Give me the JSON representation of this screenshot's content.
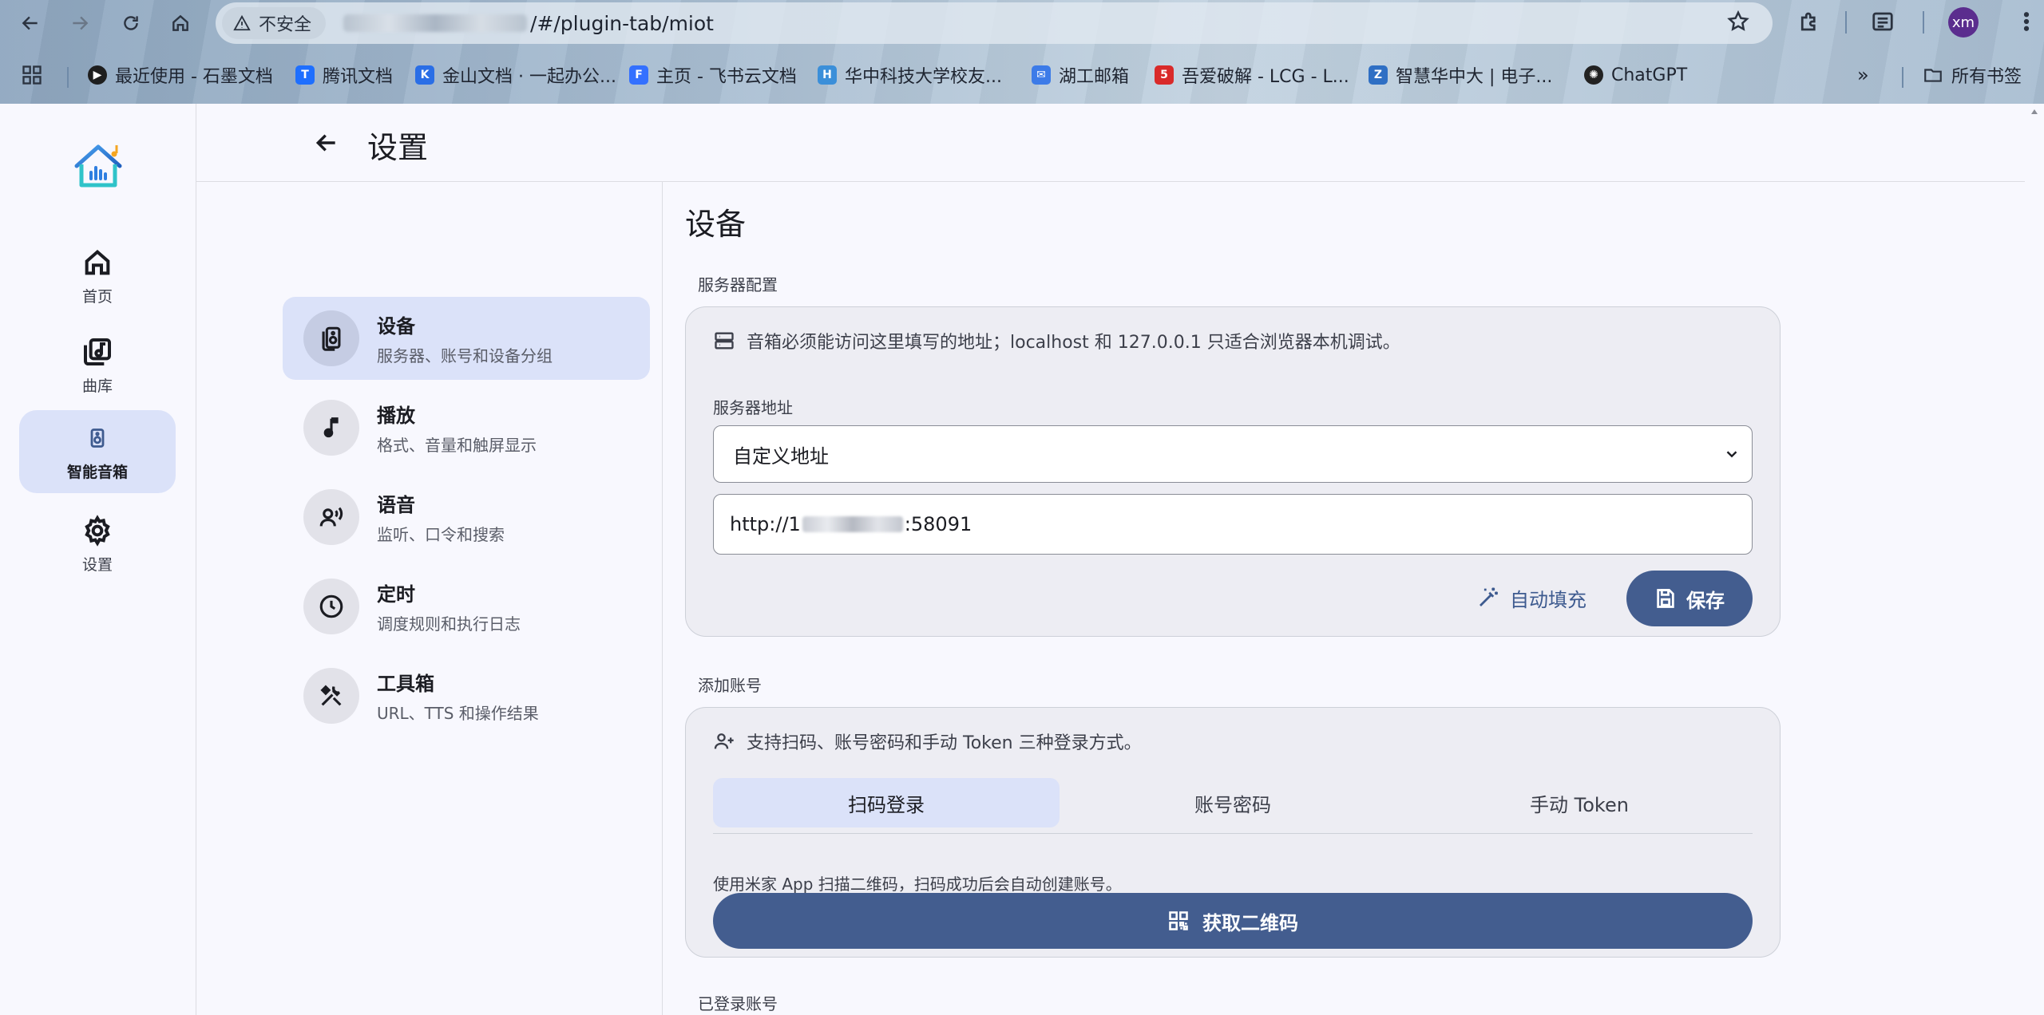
{
  "browser": {
    "security_label": "不安全",
    "url_suffix": "/#/plugin-tab/miot",
    "profile_initials": "xm",
    "bookmarks": [
      {
        "label": "最近使用 - 石墨文档",
        "icon": "shimo-icon",
        "color": "#1e1e1e"
      },
      {
        "label": "腾讯文档",
        "icon": "tencent-docs-icon",
        "color": "#1e6fff"
      },
      {
        "label": "金山文档 · 一起办公...",
        "icon": "kdocs-icon",
        "color": "#2a6ee6"
      },
      {
        "label": "主页 - 飞书云文档",
        "icon": "feishu-icon",
        "color": "#3370ff"
      },
      {
        "label": "华中科技大学校友...",
        "icon": "hust-icon",
        "color": "#3b8fd9"
      },
      {
        "label": "湖工邮箱",
        "icon": "mail-icon",
        "color": "#3c7be8"
      },
      {
        "label": "吾爱破解 - LCG - L...",
        "icon": "52pojie-icon",
        "color": "#d92a2a"
      },
      {
        "label": "智慧华中大 | 电子...",
        "icon": "hust-smart-icon",
        "color": "#2f6fc4"
      },
      {
        "label": "ChatGPT",
        "icon": "chatgpt-icon",
        "color": "#222222"
      }
    ],
    "all_bookmarks_label": "所有书签"
  },
  "rail": {
    "items": [
      {
        "label": "首页",
        "icon": "home-icon"
      },
      {
        "label": "曲库",
        "icon": "library-icon"
      },
      {
        "label": "智能音箱",
        "icon": "speaker-icon"
      },
      {
        "label": "设置",
        "icon": "gear-icon"
      }
    ]
  },
  "header": {
    "title": "设置"
  },
  "settings_nav": [
    {
      "title": "设备",
      "subtitle": "服务器、账号和设备分组",
      "icon": "devices-icon"
    },
    {
      "title": "播放",
      "subtitle": "格式、音量和触屏显示",
      "icon": "music-note-icon"
    },
    {
      "title": "语音",
      "subtitle": "监听、口令和搜索",
      "icon": "voice-icon"
    },
    {
      "title": "定时",
      "subtitle": "调度规则和执行日志",
      "icon": "clock-icon"
    },
    {
      "title": "工具箱",
      "subtitle": "URL、TTS 和操作结果",
      "icon": "tools-icon"
    }
  ],
  "content": {
    "title": "设备",
    "server_group_label": "服务器配置",
    "server_hint": "音箱必须能访问这里填写的地址；localhost 和 127.0.0.1 只适合浏览器本机调试。",
    "server_address_label": "服务器地址",
    "server_address_select": "自定义地址",
    "server_url_prefix": "http://1",
    "server_url_suffix": ":58091",
    "autofill_label": "自动填充",
    "save_label": "保存",
    "account_group_label": "添加账号",
    "account_hint": "支持扫码、账号密码和手动 Token 三种登录方式。",
    "tabs": [
      "扫码登录",
      "账号密码",
      "手动 Token"
    ],
    "active_tab": 0,
    "qr_description": "使用米家 App 扫描二维码，扫码成功后会自动创建账号。",
    "qr_button_label": "获取二维码",
    "logged_in_group_label": "已登录账号"
  },
  "colors": {
    "accent": "#435d8f",
    "active_bg": "#dbe2f9",
    "card_bg": "#ededf3"
  }
}
